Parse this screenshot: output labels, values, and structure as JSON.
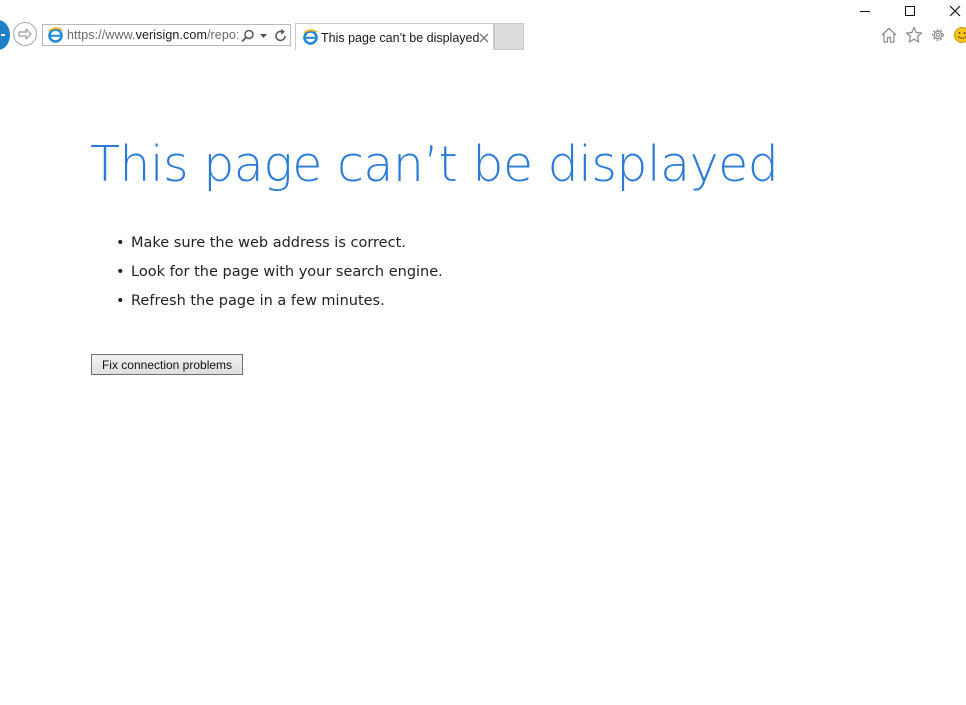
{
  "browser": {
    "address_prefix": "https://www.",
    "address_domain": "verisign.com",
    "address_suffix": "/repo:",
    "tab_title": "This page can’t be displayed",
    "icons": {
      "back": "back-arrow-icon",
      "forward": "forward-arrow-icon",
      "site": "ie-logo-icon",
      "search": "search-icon",
      "dropdown": "chevron-down-icon",
      "refresh": "refresh-icon",
      "close_tab": "close-icon",
      "home": "home-icon",
      "favorites": "star-icon",
      "settings": "gear-icon",
      "feedback": "smiley-icon"
    }
  },
  "window_controls": {
    "minimize": "minimize-icon",
    "maximize": "maximize-icon",
    "close": "close-icon"
  },
  "content": {
    "title": "This page can’t be displayed",
    "tips": [
      "Make sure the web address is correct.",
      "Look for the page with your search engine.",
      "Refresh the page in a few minutes."
    ],
    "fix_button": "Fix connection problems"
  },
  "colors": {
    "title": "#2b7bd6",
    "ie_blue": "#1e7fc7"
  }
}
